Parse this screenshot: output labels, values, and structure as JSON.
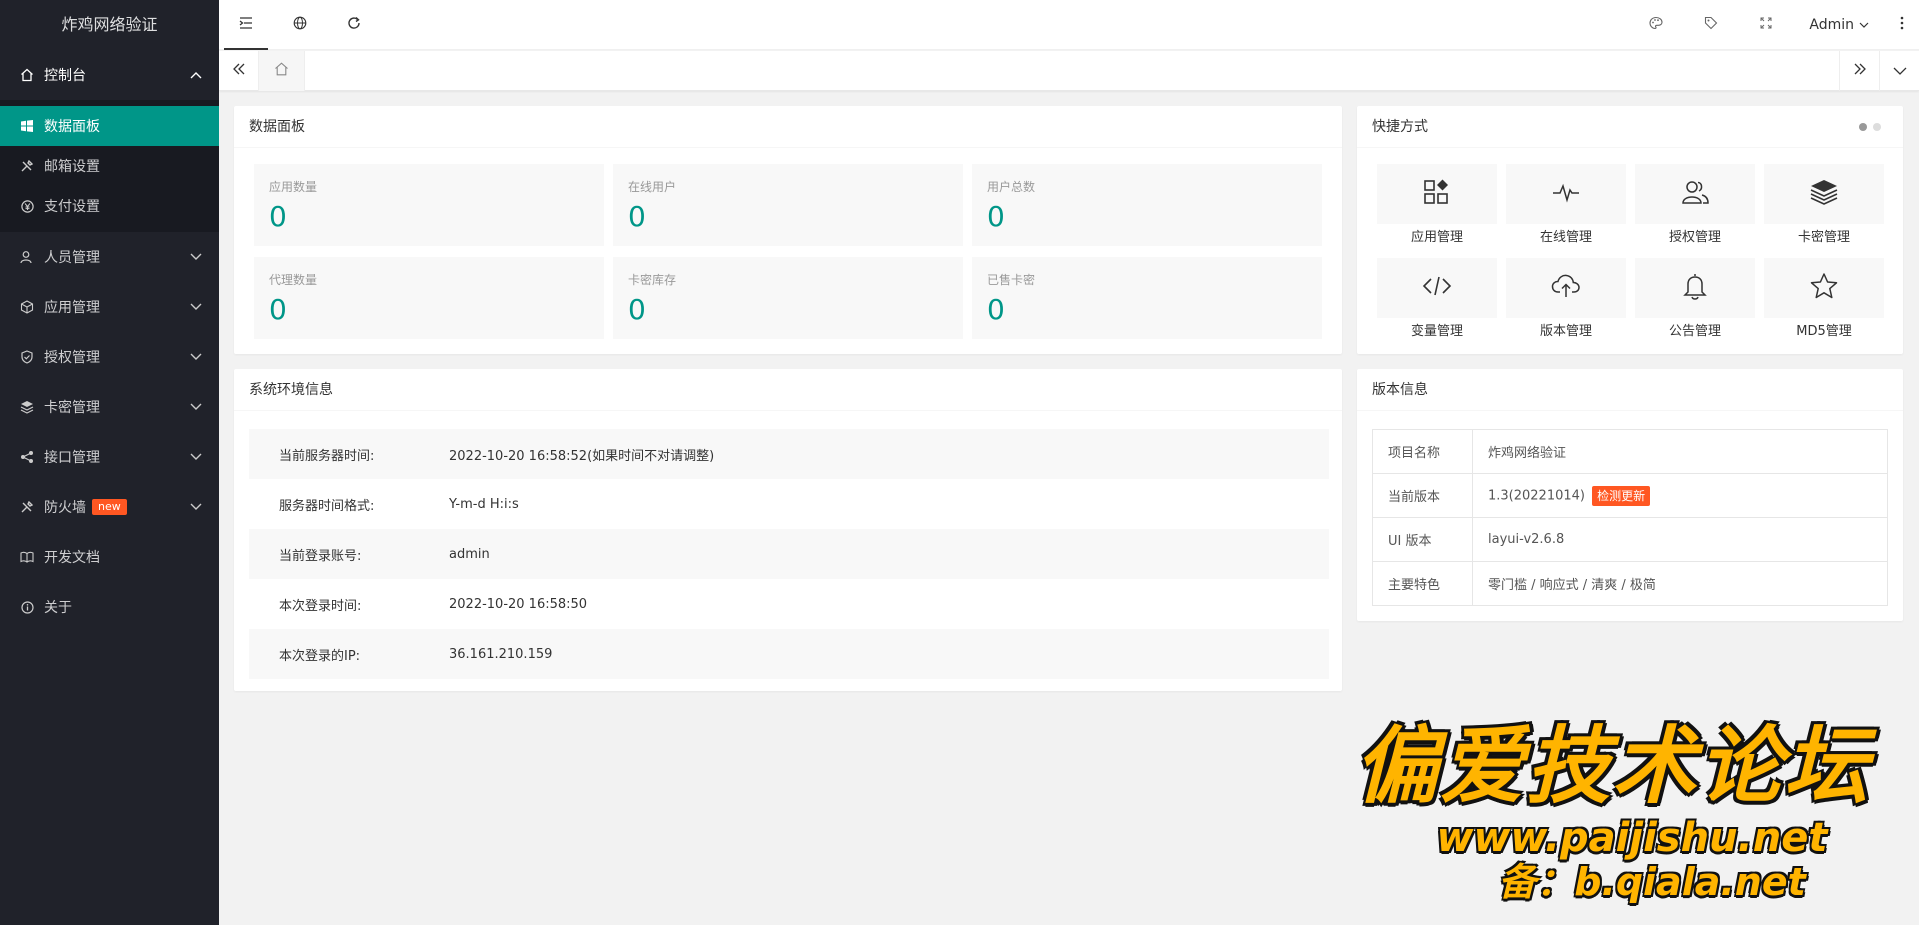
{
  "app": {
    "title": "炸鸡网络验证"
  },
  "sidebar": {
    "console": {
      "label": "控制台",
      "icon": "home-icon"
    },
    "console_items": [
      {
        "label": "数据面板",
        "icon": "windows-icon",
        "active": true
      },
      {
        "label": "邮箱设置",
        "icon": "tools-icon"
      },
      {
        "label": "支付设置",
        "icon": "yen-icon"
      }
    ],
    "groups": [
      {
        "label": "人员管理",
        "icon": "user-icon"
      },
      {
        "label": "应用管理",
        "icon": "cube-icon"
      },
      {
        "label": "授权管理",
        "icon": "shield-icon"
      },
      {
        "label": "卡密管理",
        "icon": "layers-icon"
      },
      {
        "label": "接口管理",
        "icon": "share-icon"
      },
      {
        "label": "防火墙",
        "icon": "tools-icon",
        "badge": "new"
      },
      {
        "label": "开发文档",
        "icon": "book-icon"
      },
      {
        "label": "关于",
        "icon": "info-icon"
      }
    ]
  },
  "header": {
    "user": "Admin"
  },
  "cards": {
    "data_panel": {
      "title": "数据面板",
      "stats": [
        {
          "label": "应用数量",
          "value": "0"
        },
        {
          "label": "在线用户",
          "value": "0"
        },
        {
          "label": "用户总数",
          "value": "0"
        },
        {
          "label": "代理数量",
          "value": "0"
        },
        {
          "label": "卡密库存",
          "value": "0"
        },
        {
          "label": "已售卡密",
          "value": "0"
        }
      ]
    },
    "shortcuts": {
      "title": "快捷方式",
      "items": [
        {
          "label": "应用管理",
          "icon": "apps-icon"
        },
        {
          "label": "在线管理",
          "icon": "pulse-icon"
        },
        {
          "label": "授权管理",
          "icon": "users-icon"
        },
        {
          "label": "卡密管理",
          "icon": "layers-icon"
        },
        {
          "label": "变量管理",
          "icon": "code-icon"
        },
        {
          "label": "版本管理",
          "icon": "cloud-upload-icon"
        },
        {
          "label": "公告管理",
          "icon": "bell-icon"
        },
        {
          "label": "MD5管理",
          "icon": "star-icon"
        }
      ]
    },
    "env": {
      "title": "系统环境信息",
      "rows": [
        {
          "key": "当前服务器时间:",
          "value": "2022-10-20 16:58:52(如果时间不对请调整)"
        },
        {
          "key": "服务器时间格式:",
          "value": "Y-m-d H:i:s"
        },
        {
          "key": "当前登录账号:",
          "value": "admin"
        },
        {
          "key": "本次登录时间:",
          "value": "2022-10-20 16:58:50"
        },
        {
          "key": "本次登录的IP:",
          "value": "36.161.210.159"
        }
      ]
    },
    "version": {
      "title": "版本信息",
      "rows": [
        {
          "key": "项目名称",
          "value": "炸鸡网络验证"
        },
        {
          "key": "当前版本",
          "value": "1.3(20221014)",
          "button": "检测更新"
        },
        {
          "key": "UI 版本",
          "value": "layui-v2.6.8"
        },
        {
          "key": "主要特色",
          "value": "零门槛 / 响应式 / 清爽 / 极简"
        }
      ]
    }
  },
  "watermark": {
    "title": "偏爱技术论坛",
    "url": "www.paijishu.net",
    "backup": "备：b.qiala.net"
  },
  "colors": {
    "sidebar_bg": "#20222a",
    "accent": "#009688",
    "badge": "#ff5722",
    "watermark": "#ffb400"
  }
}
